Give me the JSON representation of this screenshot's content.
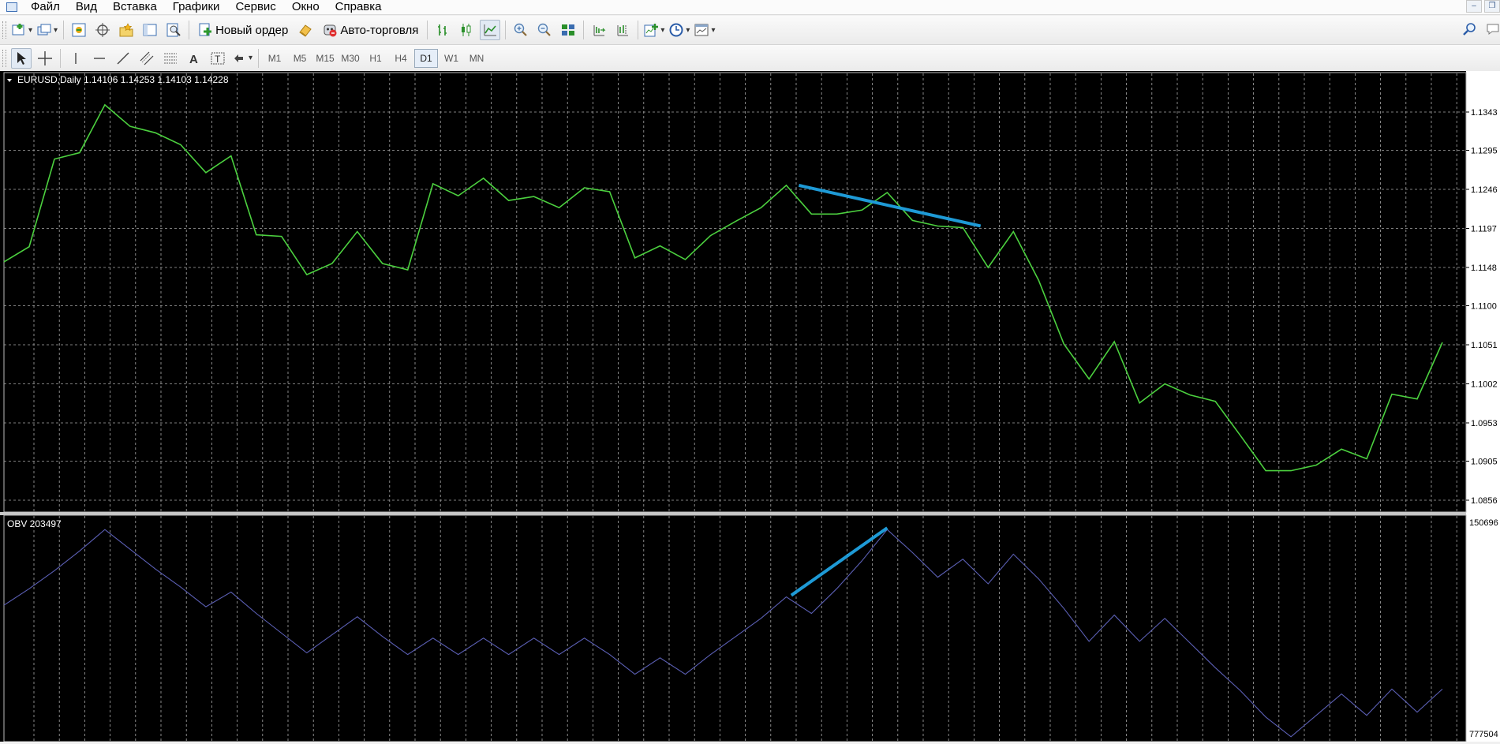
{
  "menu": [
    "Файл",
    "Вид",
    "Вставка",
    "Графики",
    "Сервис",
    "Окно",
    "Справка"
  ],
  "toolbar": {
    "new_order_label": "Новый ордер",
    "autotrade_label": "Авто-торговля"
  },
  "timeframes": [
    "M1",
    "M5",
    "M15",
    "M30",
    "H1",
    "H4",
    "D1",
    "W1",
    "MN"
  ],
  "active_timeframe": "D1",
  "main_chart": {
    "header": "EURUSD,Daily  1.14106 1.14253 1.14103 1.14228",
    "price_labels": [
      "1.1343",
      "1.1295",
      "1.1246",
      "1.1197",
      "1.1148",
      "1.1100",
      "1.1051",
      "1.1002",
      "1.0953",
      "1.0905",
      "1.0856"
    ]
  },
  "obv_chart": {
    "header": "OBV 203497",
    "top_label": "150696",
    "bottom_label": "777504"
  },
  "colors": {
    "price_line": "#4cd13f",
    "obv_line": "#5b5fb4",
    "trendline": "#1e9ad6",
    "grid": "#a8a8a8",
    "background": "#000000",
    "axis_text": "#000000"
  },
  "chart_data": [
    {
      "type": "line",
      "title": "EURUSD,Daily",
      "series": [
        {
          "name": "EURUSD",
          "values": [
            1.1155,
            1.1174,
            1.1284,
            1.1292,
            1.1352,
            1.1325,
            1.1317,
            1.1302,
            1.1267,
            1.1288,
            1.1189,
            1.1187,
            1.1139,
            1.1153,
            1.1193,
            1.1153,
            1.1145,
            1.1253,
            1.1238,
            1.126,
            1.1232,
            1.1237,
            1.1223,
            1.1248,
            1.1243,
            1.116,
            1.1175,
            1.1158,
            1.1188,
            1.1206,
            1.1223,
            1.1251,
            1.1215,
            1.1215,
            1.122,
            1.1242,
            1.1207,
            1.12,
            1.1198,
            1.1148,
            1.1193,
            1.1132,
            1.1052,
            1.1008,
            1.1055,
            1.0978,
            1.1002,
            1.0988,
            1.098,
            1.0937,
            1.0893,
            1.0893,
            1.09,
            1.092,
            1.0908,
            1.0989,
            1.0983,
            1.1054
          ]
        }
      ],
      "ylim": [
        1.0856,
        1.1343
      ],
      "y_ticks": [
        1.1343,
        1.1295,
        1.1246,
        1.1197,
        1.1148,
        1.11,
        1.1051,
        1.1002,
        1.0953,
        1.0905,
        1.0856
      ],
      "annotations": [
        {
          "type": "trendline",
          "from_index": 31.5,
          "from_value": 1.1251,
          "to_index": 38.7,
          "to_value": 1.12
        }
      ],
      "grid": true
    },
    {
      "type": "line",
      "title": "OBV 203497",
      "series": [
        {
          "name": "OBV",
          "values": [
            0.38,
            0.48,
            0.59,
            0.71,
            0.84,
            0.72,
            0.6,
            0.49,
            0.37,
            0.46,
            0.33,
            0.21,
            0.09,
            0.2,
            0.31,
            0.19,
            0.08,
            0.18,
            0.08,
            0.18,
            0.08,
            0.18,
            0.08,
            0.18,
            0.08,
            -0.04,
            0.06,
            -0.04,
            0.08,
            0.19,
            0.3,
            0.43,
            0.33,
            0.48,
            0.65,
            0.84,
            0.7,
            0.55,
            0.66,
            0.51,
            0.69,
            0.54,
            0.36,
            0.16,
            0.32,
            0.16,
            0.3,
            0.15,
            0.0,
            -0.14,
            -0.3,
            -0.42,
            -0.29,
            -0.16,
            -0.29,
            -0.13,
            -0.27,
            -0.13
          ]
        }
      ],
      "annotations": [
        {
          "type": "trendline",
          "from_index": 31.2,
          "from_value": 0.44,
          "to_index": 35.0,
          "to_value": 0.85
        }
      ],
      "grid": true
    }
  ]
}
